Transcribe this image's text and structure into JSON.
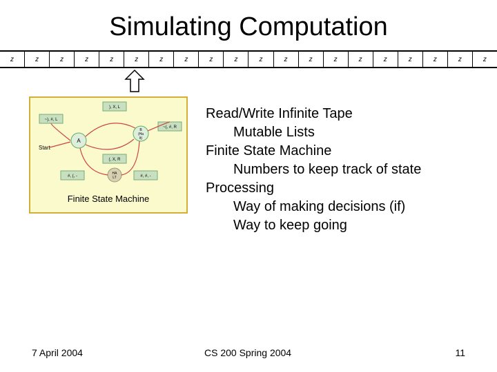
{
  "title": "Simulating Computation",
  "tape_symbol": "z",
  "tape_count": 20,
  "fsm": {
    "caption": "Finite State Machine",
    "start_label": "Start",
    "state_A": "A",
    "state_B": "B\n(Ha\nlt)",
    "state_C": "HA\nLT",
    "trans_topleft": "~), #, L",
    "trans_top": "), X, L",
    "trans_right": "~(, #, R",
    "trans_mid": "(, X, R",
    "trans_left": "#, (, -",
    "trans_bot": "#, #, -"
  },
  "explain": {
    "h1": "Read/Write Infinite Tape",
    "i1": "Mutable Lists",
    "h2": "Finite State Machine",
    "i2": "Numbers to keep track of state",
    "h3": "Processing",
    "i3a": "Way of making decisions (if)",
    "i3b": "Way to keep going"
  },
  "footer": {
    "left": "7 April 2004",
    "center": "CS 200 Spring 2004",
    "right": "11"
  }
}
